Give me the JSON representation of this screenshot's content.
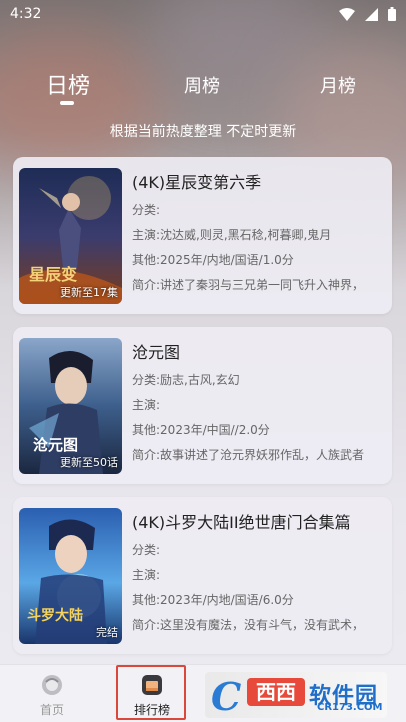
{
  "status_bar": {
    "time": "4:32"
  },
  "tabs": [
    {
      "label": "日榜",
      "active": true
    },
    {
      "label": "周榜",
      "active": false
    },
    {
      "label": "月榜",
      "active": false
    }
  ],
  "subtitle": "根据当前热度整理 不定时更新",
  "items": [
    {
      "title": "(4K)星辰变第六季",
      "category": "分类:",
      "cast": "主演:沈达威,则灵,黑石稔,柯暮卿,鬼月",
      "other": "其他:2025年/内地/国语/1.0分",
      "intro": "简介:讲述了秦羽与三兄弟一同飞升入神界，",
      "badge": "更新至17集",
      "poster_logo": "星辰变"
    },
    {
      "title": "沧元图",
      "category": "分类:励志,古风,玄幻",
      "cast": "主演:",
      "other": "其他:2023年/中国//2.0分",
      "intro": "简介:故事讲述了沧元界妖邪作乱，人族武者",
      "badge": "更新至50话",
      "poster_logo": "沧元图"
    },
    {
      "title": "(4K)斗罗大陆II绝世唐门合集篇",
      "category": "分类:",
      "cast": "主演:",
      "other": "其他:2023年/内地/国语/6.0分",
      "intro": "简介:这里没有魔法，没有斗气，没有武术，",
      "badge": "完结",
      "poster_logo": "斗罗大陆"
    }
  ],
  "bottom_nav": [
    {
      "label": "首页",
      "icon": "home-icon"
    },
    {
      "label": "排行榜",
      "icon": "ranking-icon"
    }
  ],
  "watermark": {
    "brand": "西西",
    "text": "软件园",
    "url": "CR173.COM",
    "letter": "C"
  },
  "colors": {
    "highlight": "#d9483b",
    "card": "#eeecf3"
  }
}
